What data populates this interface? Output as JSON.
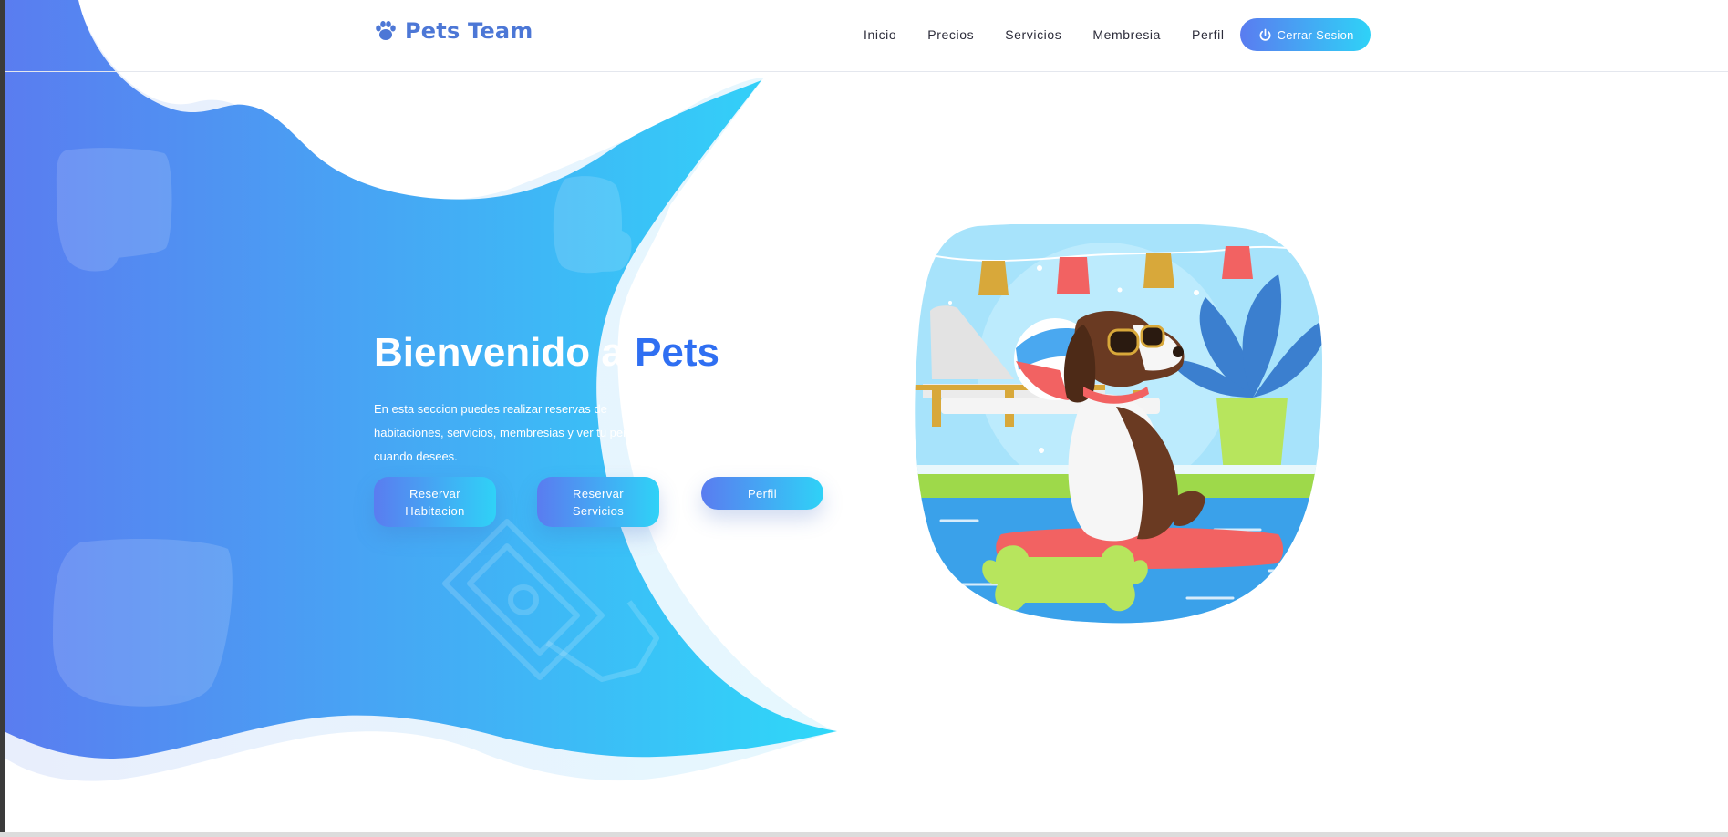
{
  "brand": {
    "name": "Pets Team",
    "icon": "paw-icon"
  },
  "nav": {
    "links": [
      "Inicio",
      "Precios",
      "Servicios",
      "Membresia",
      "Perfil"
    ],
    "logout": {
      "label": "Cerrar Sesion",
      "icon": "power-icon"
    }
  },
  "hero": {
    "title_prefix": "Bienvenido a ",
    "title_accent": "Pets",
    "description": "En esta seccion puedes realizar reservas de habitaciones, servicios, membresias y ver tu perfil cuando desees.",
    "buttons": [
      "Reservar Habitacion",
      "Reservar Servicios",
      "Perfil"
    ]
  },
  "illustration": {
    "name": "dog-pool-illustration"
  },
  "colors": {
    "brand": "#4c77d6",
    "title_accent": "#2f6ff2",
    "gradient_start": "#5a7cf0",
    "gradient_end": "#2fd2f7"
  }
}
